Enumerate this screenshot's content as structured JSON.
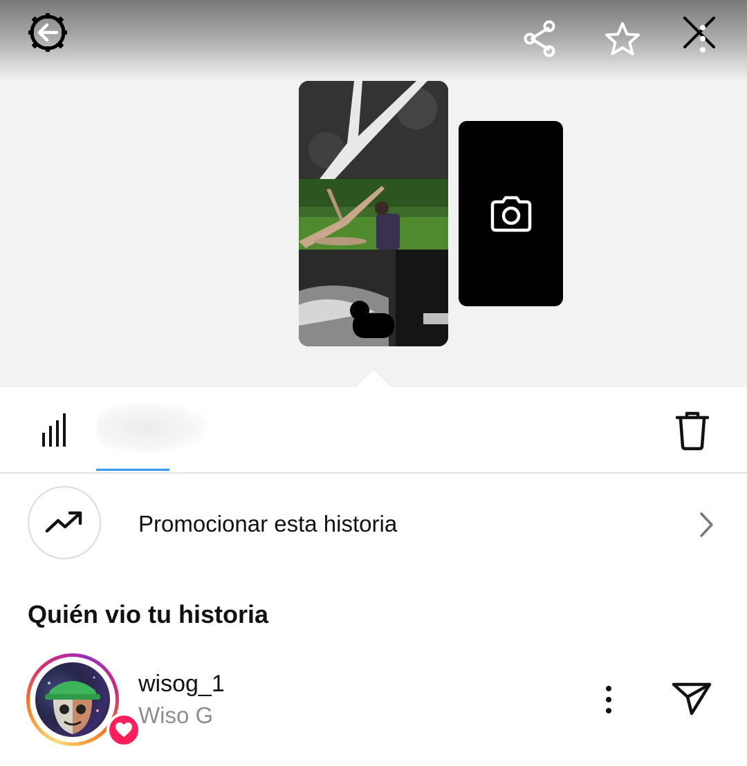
{
  "header": {
    "back_icon": "back-arrow-icon",
    "share_icon": "share-icon",
    "star_icon": "star-icon",
    "close_icon": "close-icon"
  },
  "story_preview": {
    "add_story_icon": "camera-icon"
  },
  "tabs": {
    "insights_icon": "bar-chart-icon",
    "delete_icon": "trash-icon",
    "indicator_color": "#3897f0"
  },
  "promote": {
    "icon": "trending-up-icon",
    "label": "Promocionar esta historia",
    "chevron_icon": "chevron-right-icon"
  },
  "viewers": {
    "title": "Quién vio tu historia",
    "items": [
      {
        "username": "wisog_1",
        "full_name": "Wiso G",
        "reaction_icon": "heart-icon",
        "more_icon": "more-vertical-icon",
        "send_icon": "send-icon",
        "badge_color": "#ff1f5a"
      }
    ]
  }
}
